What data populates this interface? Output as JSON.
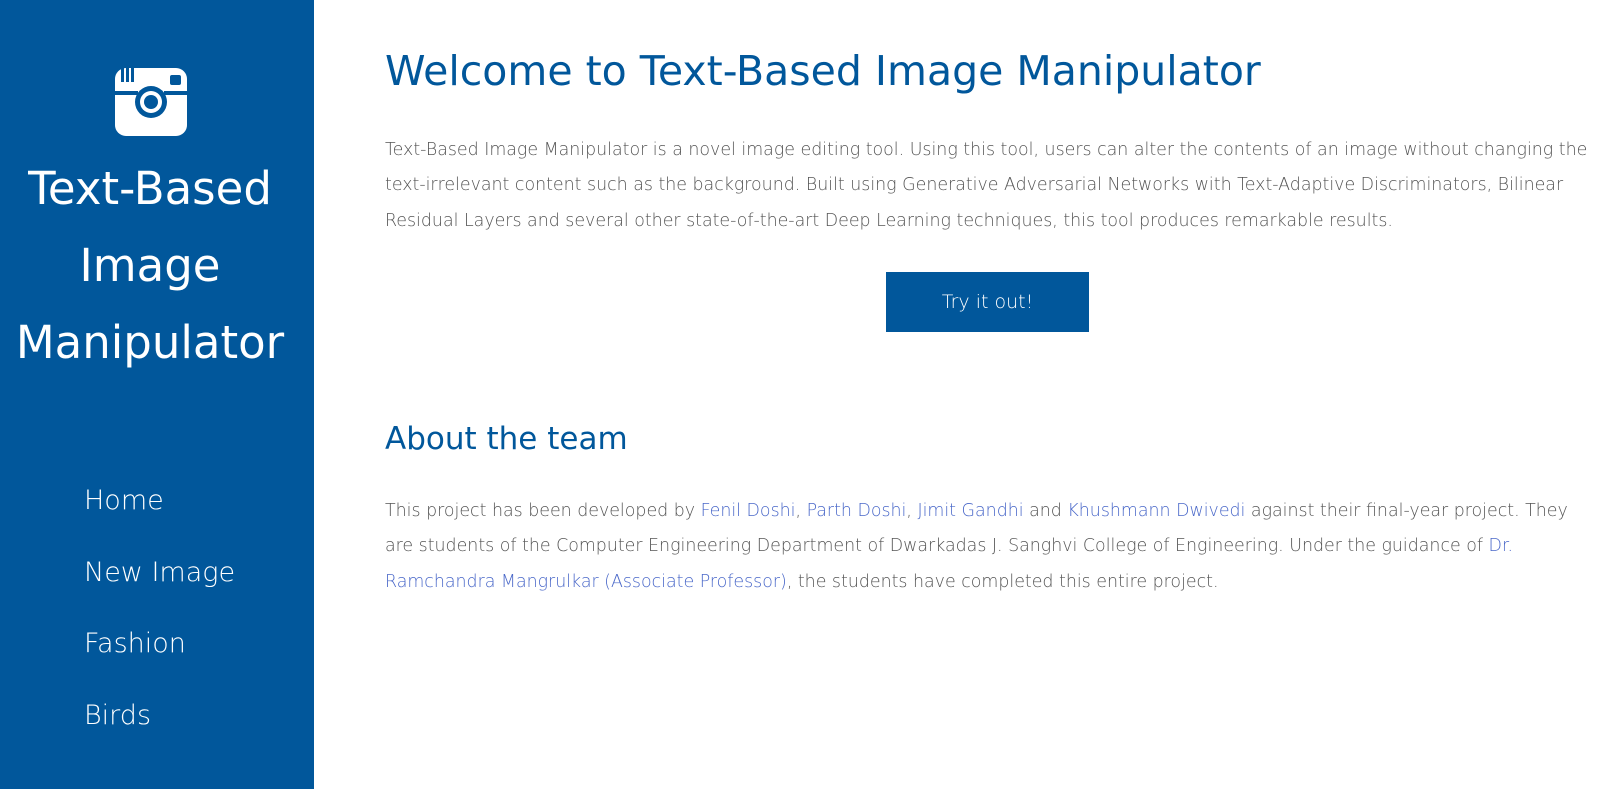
{
  "sidebar": {
    "logo_icon": "instagram-camera-icon",
    "brand_lines": [
      "Text-Based",
      "Image",
      "Manipulator"
    ],
    "nav": [
      "Home",
      "New Image",
      "Fashion",
      "Birds"
    ]
  },
  "main": {
    "title": "Welcome to Text-Based Image Manipulator",
    "intro": "Text-Based Image Manipulator is a novel image editing tool. Using this tool, users can alter the contents of an image without changing the text-irrelevant content such as the background. Built using Generative Adversarial Networks with Text-Adaptive Discriminators, Bilinear Residual Layers and several other state-of-the-art Deep Learning techniques, this tool produces remarkable results.",
    "cta_label": "Try it out!",
    "about_title": "About the team",
    "about": {
      "prefix": "This project has been developed by ",
      "member1": "Fenil Doshi",
      "sep1": ", ",
      "member2": "Parth Doshi",
      "sep2": ", ",
      "member3": "Jimit Gandhi",
      "sep3": " and ",
      "member4": "Khushmann Dwivedi",
      "middle": " against their final-year project. They are students of the Computer Engineering Department of Dwarkadas J. Sanghvi College of Engineering. Under the guidance of ",
      "guide": "Dr. Ramchandra Mangrulkar (Associate Professor)",
      "suffix": ", the students have completed this entire project."
    }
  },
  "colors": {
    "brand": "#01579b",
    "link": "#4a68c9",
    "body_text": "#555555"
  }
}
